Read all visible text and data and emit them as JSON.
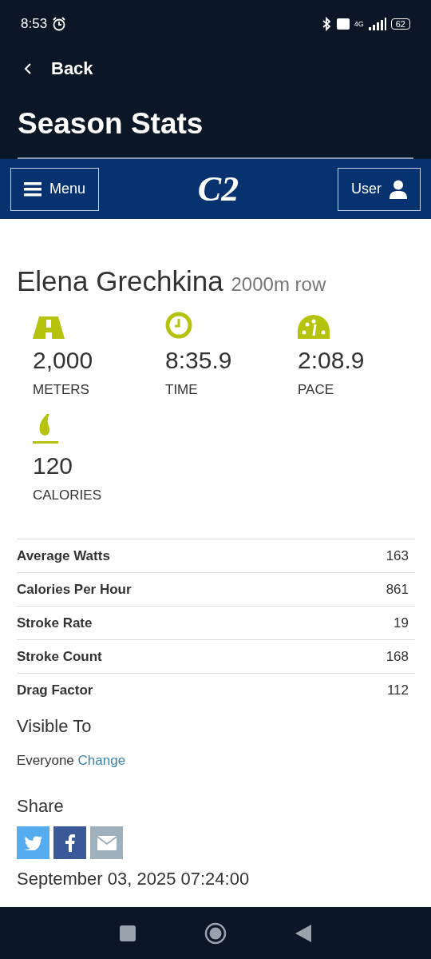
{
  "status_bar": {
    "time": "8:53",
    "network": "4G",
    "battery": "62"
  },
  "header": {
    "back": "Back",
    "title": "Season Stats"
  },
  "navbar": {
    "menu": "Menu",
    "logo": "C2",
    "user": "User"
  },
  "workout": {
    "athlete": "Elena Grechkina",
    "type": "2000m row"
  },
  "stats": [
    {
      "kind": "distance",
      "value": "2,000",
      "label": "METERS"
    },
    {
      "kind": "time",
      "value": "8:35.9",
      "label": "TIME"
    },
    {
      "kind": "pace",
      "value": "2:08.9",
      "label": "PACE"
    },
    {
      "kind": "calories",
      "value": "120",
      "label": "CALORIES"
    }
  ],
  "details": [
    {
      "label": "Average Watts",
      "value": "163"
    },
    {
      "label": "Calories Per Hour",
      "value": "861"
    },
    {
      "label": "Stroke Rate",
      "value": "19"
    },
    {
      "label": "Stroke Count",
      "value": "168"
    },
    {
      "label": "Drag Factor",
      "value": "112"
    }
  ],
  "visibility": {
    "heading": "Visible To",
    "value": "Everyone",
    "link": "Change"
  },
  "share": {
    "heading": "Share",
    "buttons": [
      {
        "kind": "twitter"
      },
      {
        "kind": "facebook"
      },
      {
        "kind": "email"
      }
    ]
  },
  "date": "September 03, 2025 07:24:00"
}
